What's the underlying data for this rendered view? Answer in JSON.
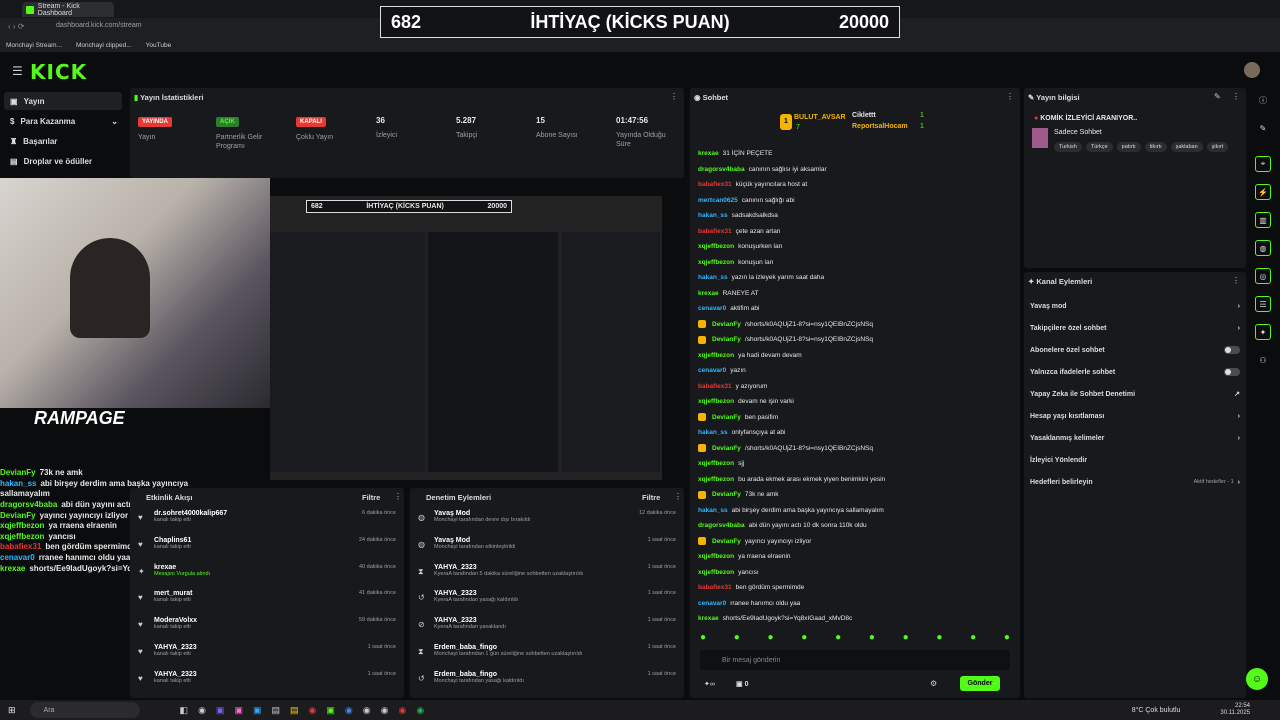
{
  "browser": {
    "tab_title": "Stream - Kick Dashboard",
    "url": "dashboard.kick.com/stream",
    "bookmarks": [
      "Monchayi Stream...",
      "Monchayi clipped...",
      "YouTube"
    ]
  },
  "overlay": {
    "left": "682",
    "center": "İHTİYAÇ (KİCKS PUAN)",
    "right": "20000"
  },
  "header": {
    "logo": "KICK"
  },
  "sidebar": {
    "items": [
      {
        "label": "Yayın",
        "active": true
      },
      {
        "label": "Para Kazanma"
      },
      {
        "label": "Başarılar"
      },
      {
        "label": "Droplar ve ödüller"
      }
    ]
  },
  "stats": {
    "title": "Yayın İstatistikleri",
    "items": [
      {
        "badge": "YAYINDA",
        "color": "#e53935",
        "label": "Yayın"
      },
      {
        "badge": "AÇIK",
        "color": "#2e7d32",
        "label": "Partnerlik Gelir Programı"
      },
      {
        "badge": "KAPALI",
        "color": "#e53935",
        "label": "Çoklu Yayın"
      },
      {
        "value": "36",
        "label": "İzleyici"
      },
      {
        "value": "5.287",
        "label": "Takipçi"
      },
      {
        "value": "15",
        "label": "Abone Sayısı"
      },
      {
        "value": "01:47:56",
        "label": "Yayında Olduğu Süre"
      }
    ]
  },
  "webcam": {
    "brand": "RAMPAGE"
  },
  "activity": {
    "title": "Etkinlik Akışı",
    "filter": "Filtre",
    "rows": [
      {
        "name": "dr.sohret4000kalip667",
        "sub": "kanalı takip etti",
        "time": "6 dakika önce"
      },
      {
        "name": "Chaplins61",
        "sub": "kanalı takip etti",
        "time": "24 dakika önce"
      },
      {
        "name": "krexae",
        "sub": "Mesajını Vurgula alındı",
        "time": "40 dakika önce"
      },
      {
        "name": "mert_murat",
        "sub": "kanalı takip etti",
        "time": "41 dakika önce"
      },
      {
        "name": "ModeraVolxx",
        "sub": "kanalı takip etti",
        "time": "59 dakika önce"
      },
      {
        "name": "YAHYA_2323",
        "sub": "kanalı takip etti",
        "time": "1 saat önce"
      },
      {
        "name": "YAHYA_2323",
        "sub": "kanalı takip etti",
        "time": "1 saat önce"
      }
    ]
  },
  "moderation": {
    "title": "Denetim Eylemleri",
    "filter": "Filtre",
    "rows": [
      {
        "name": "Yavaş Mod",
        "sub": "Monchayi tarafından devre dışı bırakıldı",
        "time": "12 dakika önce"
      },
      {
        "name": "Yavaş Mod",
        "sub": "Monchayi tarafından etkinleştirildi",
        "time": "1 saat önce"
      },
      {
        "name": "YAHYA_2323",
        "sub": "KyeraA tarafından 5 dakika süreliğine sohbetten uzaklaştırıldı",
        "time": "1 saat önce"
      },
      {
        "name": "YAHYA_2323",
        "sub": "KyeraA tarafından yasağı kaldırıldı",
        "time": "1 saat önce"
      },
      {
        "name": "YAHYA_2323",
        "sub": "KyeraA tarafından yasaklandı",
        "time": "1 saat önce"
      },
      {
        "name": "Erdem_baba_fingo",
        "sub": "Monchayi tarafından 1 gün süreliğine sohbetten uzaklaştırıldı",
        "time": "1 saat önce"
      },
      {
        "name": "Erdem_baba_fingo",
        "sub": "Monchayi tarafından yasağı kaldırıldı",
        "time": "1 saat önce"
      }
    ]
  },
  "chat": {
    "title": "Sohbet",
    "leaderboard": [
      {
        "name": "BULUT_AVSAR",
        "value": "7"
      },
      {
        "name": "Ciklettt",
        "value": "1"
      },
      {
        "name": "ReportsalHocam",
        "value": "1"
      }
    ],
    "messages": [
      {
        "user": "krexae",
        "color": "#53fc18",
        "text": "31 İÇİN PEÇETE"
      },
      {
        "user": "dragorsv4baba",
        "color": "#53fc18",
        "text": "canının sağlısı iyi aksamlar"
      },
      {
        "user": "babafiex31",
        "color": "#e53935",
        "text": "küçük yayıncılara host at"
      },
      {
        "user": "mertcan0625",
        "color": "#2fb8ff",
        "text": "canının sağlığı abi"
      },
      {
        "user": "hakan_ss",
        "color": "#2fb8ff",
        "text": "sadsakdsalkdsa"
      },
      {
        "user": "babafiex31",
        "color": "#e53935",
        "text": "çete azan artan"
      },
      {
        "user": "xqjeffbezon",
        "color": "#53fc18",
        "text": "konuşurken lan"
      },
      {
        "user": "xqjeffbezon",
        "color": "#53fc18",
        "text": "konuşun lan"
      },
      {
        "user": "hakan_ss",
        "color": "#2fb8ff",
        "text": "yazın la izleyek yarım saat daha"
      },
      {
        "user": "krexae",
        "color": "#53fc18",
        "text": "RANEYE AT"
      },
      {
        "user": "cenavar0",
        "color": "#2fb8ff",
        "text": "aktifim abi"
      },
      {
        "user": "DevianFy",
        "color": "#53fc18",
        "text": "/shorts/k0AQUjZ1-8?si=nsy1QEIBnZCjsNSq",
        "badge": true
      },
      {
        "user": "DevianFy",
        "color": "#53fc18",
        "text": "/shorts/k0AQUjZ1-8?si=nsy1QEIBnZCjsNSq",
        "badge": true
      },
      {
        "user": "xqjeffbezon",
        "color": "#53fc18",
        "text": "ya hadi devam devam"
      },
      {
        "user": "cenavar0",
        "color": "#2fb8ff",
        "text": "yazın"
      },
      {
        "user": "babafiex31",
        "color": "#e53935",
        "text": "y azıyorum"
      },
      {
        "user": "xqjeffbezon",
        "color": "#53fc18",
        "text": "devam ne işin varki"
      },
      {
        "user": "DevianFy",
        "color": "#53fc18",
        "text": "ben pasifim",
        "badge": true
      },
      {
        "user": "hakan_ss",
        "color": "#2fb8ff",
        "text": "onlyfansçıya at abi"
      },
      {
        "user": "DevianFy",
        "color": "#53fc18",
        "text": "/shorts/k0AQUjZ1-8?si=nsy1QEIBnZCjsNSq",
        "badge": true
      },
      {
        "user": "xqjeffbezon",
        "color": "#53fc18",
        "text": "sjj"
      },
      {
        "user": "xqjeffbezon",
        "color": "#53fc18",
        "text": "bu arada ekmek arası ekmek yiyen benimkini yesin"
      },
      {
        "user": "DevianFy",
        "color": "#53fc18",
        "text": "73k ne amk",
        "badge": true
      },
      {
        "user": "hakan_ss",
        "color": "#2fb8ff",
        "text": "abi birşey derdim ama başka yayıncıya sallamayalım"
      },
      {
        "user": "dragorsv4baba",
        "color": "#53fc18",
        "text": "abi dün yayını actı 10 dk sonra 110k oldu"
      },
      {
        "user": "DevianFy",
        "color": "#53fc18",
        "text": "yayıncı yayıncıyı izliyor",
        "badge": true
      },
      {
        "user": "xqjeffbezon",
        "color": "#53fc18",
        "text": "ya rraena elraenin"
      },
      {
        "user": "xqjeffbezon",
        "color": "#53fc18",
        "text": "yancısı"
      },
      {
        "user": "babafiex31",
        "color": "#e53935",
        "text": "ben gördüm spermimde"
      },
      {
        "user": "cenavar0",
        "color": "#2fb8ff",
        "text": "rranee hanımcı oldu yaa"
      },
      {
        "user": "krexae",
        "color": "#53fc18",
        "text": "shorts/Ee9IadUgoyk?si=Yq8xIGaad_xMvD8c"
      }
    ],
    "input_placeholder": "Bir mesaj gönderin",
    "points": "0",
    "send_label": "Gönder"
  },
  "stream_info": {
    "title": "Yayın bilgisi",
    "stream_title": "KOMİK İZLEYİCİ ARANIYOR..",
    "category": "Sadece Sohbet",
    "tags": [
      "Turkish",
      "Türkçe",
      "patırtı",
      "tikırtı",
      "şaklaban",
      "şikırt"
    ]
  },
  "channel_actions": {
    "title": "Kanal Eylemleri",
    "items": [
      {
        "label": "Yavaş mod",
        "kind": "arrow"
      },
      {
        "label": "Takipçilere özel sohbet",
        "kind": "arrow"
      },
      {
        "label": "Abonelere özel sohbet",
        "kind": "toggle"
      },
      {
        "label": "Yalnızca ifadelerle sohbet",
        "kind": "toggle"
      },
      {
        "label": "Yapay Zeka ile Sohbet Denetimi",
        "kind": "ext"
      },
      {
        "label": "Hesap yaşı kısıtlaması",
        "kind": "arrow"
      },
      {
        "label": "Yasaklanmış kelimeler",
        "kind": "arrow"
      },
      {
        "label": "İzleyici Yönlendir",
        "kind": "none"
      },
      {
        "label": "Hedefleri belirleyin",
        "kind": "arrow",
        "extra": "Aktif hedefler - 1"
      }
    ]
  },
  "left_chat": [
    {
      "user": "DevianFy",
      "color": "#53fc18",
      "text": "73k ne amk"
    },
    {
      "user": "hakan_ss",
      "color": "#2fb8ff",
      "text": "abi birşey derdim ama başka yayıncıya sallamayalım"
    },
    {
      "user": "dragorsv4baba",
      "color": "#53fc18",
      "text": "abi dün yayını actı 10 dk sonra 110k oldu"
    },
    {
      "user": "DevianFy",
      "color": "#53fc18",
      "text": "yayıncı yayıncıyı izliyor"
    },
    {
      "user": "xqjeffbezon",
      "color": "#53fc18",
      "text": "ya rraena elraenin"
    },
    {
      "user": "xqjeffbezon",
      "color": "#53fc18",
      "text": "yancısı"
    },
    {
      "user": "babafiex31",
      "color": "#e53935",
      "text": "ben gördüm spermimde"
    },
    {
      "user": "cenavar0",
      "color": "#2fb8ff",
      "text": "rranee hanımcı oldu yaa"
    },
    {
      "user": "krexae",
      "color": "#53fc18",
      "text": "shorts/Ee9IadUgoyk?si=Yq8xIGaad_xMvD8c"
    }
  ],
  "taskbar": {
    "search": "Ara",
    "weather": "8°C Çok bulutlu",
    "time": "22:54",
    "date": "30.11.2025"
  }
}
